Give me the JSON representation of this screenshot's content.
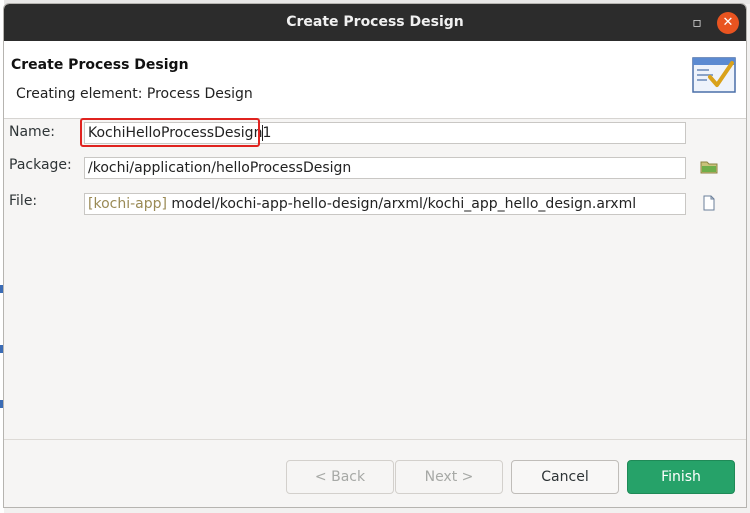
{
  "dialog": {
    "title": "Create Process Design",
    "banner_title": "Create Process Design",
    "banner_message": "Creating element: Process Design"
  },
  "form": {
    "name_label": "Name:",
    "name_value": "KochiHelloProcessDesign1",
    "package_label": "Package:",
    "package_value": "/kochi/application/helloProcessDesign",
    "file_label": "File:",
    "file_project": "[kochi-app]",
    "file_path": "model/kochi-app-hello-design/arxml/kochi_app_hello_design.arxml"
  },
  "buttons": {
    "back": "< Back",
    "next": "Next >",
    "cancel": "Cancel",
    "finish": "Finish"
  },
  "icons": {
    "minimize": "minimize-icon",
    "close": "close-icon",
    "wizard": "wizard-checklist-icon",
    "browse_package": "folder-icon",
    "browse_file": "file-icon"
  },
  "colors": {
    "finish": "#26a269",
    "titlebar": "#2c2c2c",
    "highlight": "#e0231f"
  }
}
